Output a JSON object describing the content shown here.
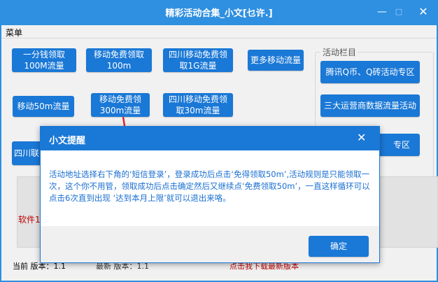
{
  "window": {
    "title": "精彩活动合集_小文[乜许.]",
    "min_glyph": "—",
    "max_glyph": "□",
    "close_glyph": "✕"
  },
  "menu": {
    "label": "菜单"
  },
  "buttons": [
    {
      "label_l1": "一分钱领取",
      "label_l2": "100M流量"
    },
    {
      "label_l1": "移动免费领取",
      "label_l2": "100m"
    },
    {
      "label_l1": "四川移动免费领",
      "label_l2": "取1G流量"
    },
    {
      "label_l1": "更多移动流量",
      "label_l2": ""
    },
    {
      "label_l1": "移动50m流量",
      "label_l2": ""
    },
    {
      "label_l1": "移动免费领",
      "label_l2": "300m流量"
    },
    {
      "label_l1": "四川移动免费领",
      "label_l2": "取30m流量"
    }
  ],
  "partial_button": {
    "label": "四川联"
  },
  "group": {
    "title": "活动栏目",
    "items": [
      {
        "label": "腾讯Q币、Q砖活动专区"
      },
      {
        "label": "三大运营商数据流量活动"
      },
      {
        "label": "专区"
      }
    ]
  },
  "panel": {
    "label": "软件",
    "red_text": "软件1"
  },
  "status": {
    "current": "当前  版本：1.1",
    "latest": "最新  版本：1.1",
    "download": "点击我下载最新版本"
  },
  "dialog": {
    "title": "小文提醒",
    "close_glyph": "✕",
    "message": "活动地址选择右下角的‘短信登录’，登录成功后点击‘免得领取50m’,活动规则是只能领取一次，这个你不用管，领取成功后点击确定然后又继续点‘免费领取50m’，一直这样循环可以点击6次直到出现 ‘达到本月上限’就可以退出来咯。",
    "ok_label": "确定"
  },
  "colors": {
    "title_bar": "#2f8fe0",
    "button": "#1a78d6",
    "arrow": "#e3262f",
    "dialog_text": "#1a6fd0"
  }
}
